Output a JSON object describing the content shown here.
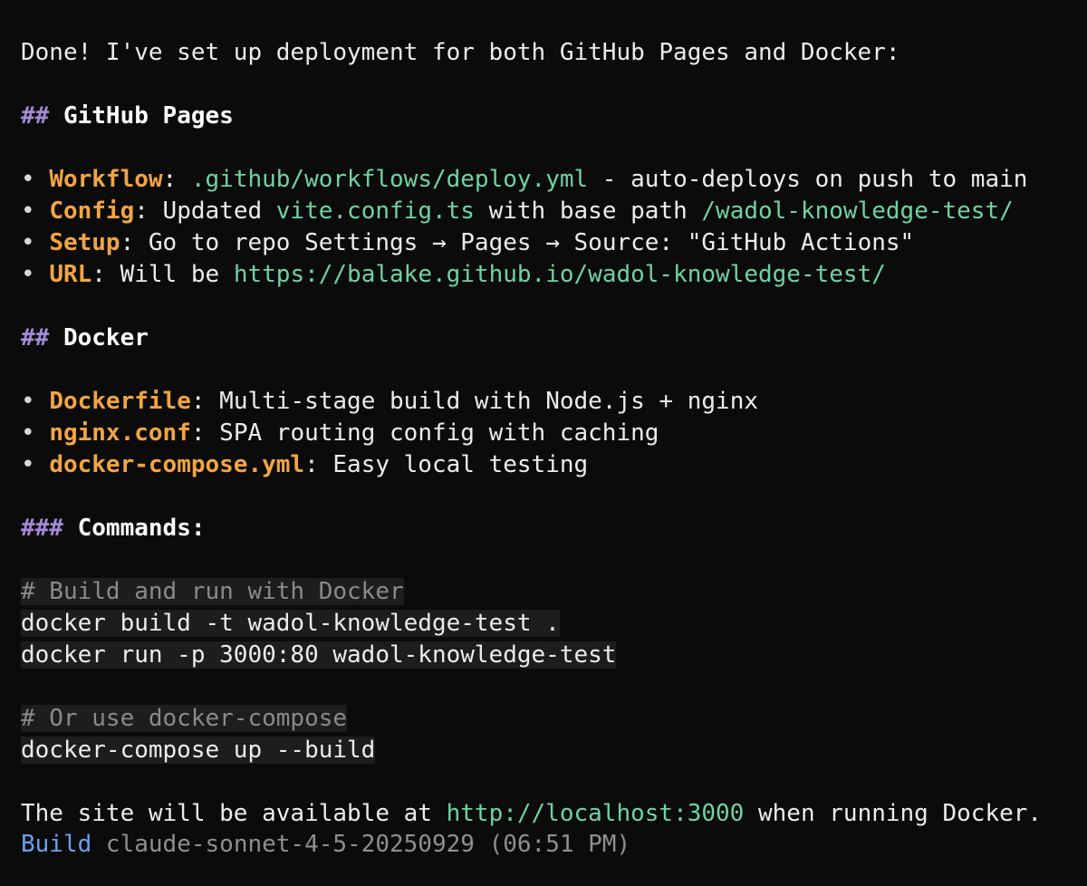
{
  "intro": "Done! I've set up deployment for both GitHub Pages and Docker:",
  "section1": {
    "hash": "##",
    "title": "GitHub Pages",
    "items": [
      {
        "bullet": "•",
        "key": "Workflow",
        "sep": ": ",
        "path": ".github/workflows/deploy.yml",
        "rest": " - auto-deploys on push to main"
      },
      {
        "bullet": "•",
        "key": "Config",
        "sep": ": ",
        "pre": "Updated ",
        "file": "vite.config.ts",
        "mid": " with base path ",
        "base": "/wadol-knowledge-test/"
      },
      {
        "bullet": "•",
        "key": "Setup",
        "sep": ": ",
        "text": "Go to repo Settings → Pages → Source: \"GitHub Actions\""
      },
      {
        "bullet": "•",
        "key": "URL",
        "sep": ": ",
        "pre": "Will be ",
        "url": "https://balake.github.io/wadol-knowledge-test/"
      }
    ]
  },
  "section2": {
    "hash": "##",
    "title": "Docker",
    "items": [
      {
        "bullet": "•",
        "key": "Dockerfile",
        "sep": ": ",
        "text": "Multi-stage build with Node.js + nginx"
      },
      {
        "bullet": "•",
        "key": "nginx.conf",
        "sep": ": ",
        "text": "SPA routing config with caching"
      },
      {
        "bullet": "•",
        "key": "docker-compose.yml",
        "sep": ": ",
        "text": "Easy local testing"
      }
    ]
  },
  "section3": {
    "hash": "###",
    "title": "Commands:"
  },
  "code1": {
    "comment": "# Build and run with Docker",
    "line1": "docker build -t wadol-knowledge-test .",
    "line2": "docker run -p 3000:80 wadol-knowledge-test"
  },
  "code2": {
    "comment": "# Or use docker-compose",
    "line1": "docker-compose up --build"
  },
  "outro": {
    "pre": "The site will be available at ",
    "url": "http://localhost:3000",
    "post": " when running Docker."
  },
  "status": {
    "label": "Build",
    "model": " claude-sonnet-4-5-20250929",
    "time": " (06:51 PM)"
  }
}
